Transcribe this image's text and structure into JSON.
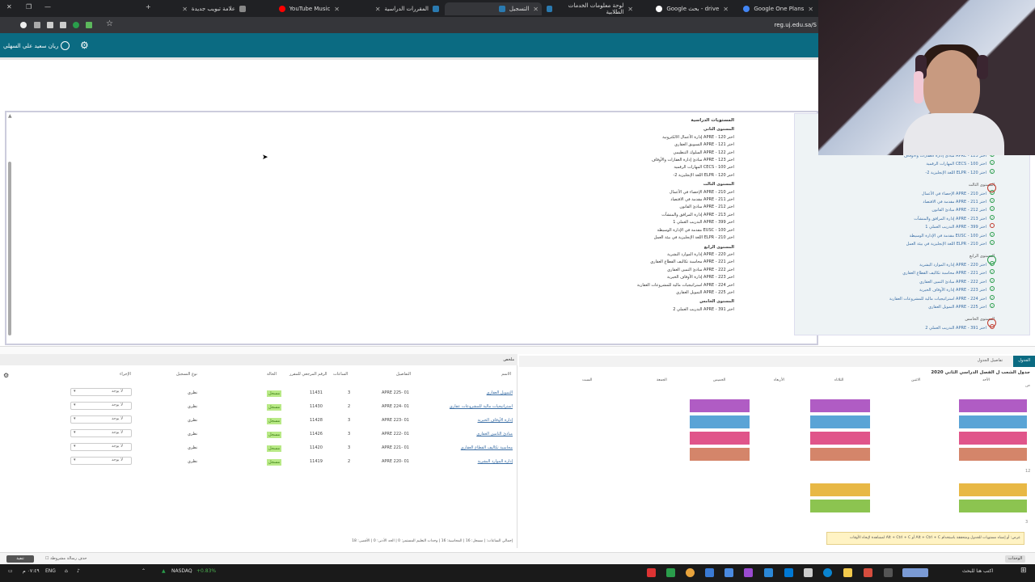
{
  "browser": {
    "tabs": [
      {
        "label": "علامة تبويب جديدة",
        "active": false
      },
      {
        "label": "YouTube Music",
        "active": false
      },
      {
        "label": "المقررات الدراسية",
        "active": false
      },
      {
        "label": "التسجيل",
        "active": true
      },
      {
        "label": "لوحة معلومات الخدمات الطلابية",
        "active": false
      },
      {
        "label": "drive - بحث Google",
        "active": false
      },
      {
        "label": "Google One Plans",
        "active": false
      }
    ],
    "url": "reg.uj.edu.sa/S"
  },
  "app": {
    "user_name": "ريان سعيد علي السهلي"
  },
  "plan": {
    "heading": "المستويات الدراسية",
    "levels": [
      {
        "title": "المستوى الثاني",
        "items": [
          "اختر APRE - 120 إدارة الأعمال الالكترونية",
          "اختر APRE - 121 التسويق العقاري",
          "اختر APRE - 122 السلوك التنظيمي",
          "اختر APRE - 123 مبادئ إدارة العقارات والأوقاف",
          "اختر CECS - 100 المهارات الرقمية",
          "اختر ELPR - 120 اللغة الإنجليزية 2-"
        ]
      },
      {
        "title": "المستوى الثالث",
        "items": [
          "اختر APRE - 210 الإحصاء في الأعمال",
          "اختر APRE - 211 مقدمة في الاقتصاد",
          "اختر APRE - 212 مبادئ القانون",
          "اختر APRE - 213 إدارة المرافق والمنشآت",
          "اختر APRE - 399 التدريب العملي 1",
          "اختر EUSC - 100 مقدمة في الإدارة الوسيطة",
          "اختر ELPR - 210 اللغة الإنجليزية في بيئة العمل"
        ]
      },
      {
        "title": "المستوى الرابع",
        "items": [
          "اختر APRE - 220 إدارة الموارد البشرية",
          "اختر APRE - 221 محاسبة تكاليف القطاع العقاري",
          "اختر APRE - 222 مبادئ التمين العقاري",
          "اختر APRE - 223 إدارة الأوقاف الخيرية",
          "اختر APRE - 224 استراتيجيات مالية للمشروعات العقارية",
          "اختر APRE - 225 التمويل العقاري"
        ]
      },
      {
        "title": "المستوى الخامس",
        "items": [
          "اختر APRE - 391 التدريب العملي 2"
        ]
      }
    ]
  },
  "progress_panel": {
    "items": [
      {
        "text": "اختر APRE - 123 مبادئ إدارة العقارات والأوقاف",
        "state": "ok"
      },
      {
        "text": "اختر CECS - 100 المهارات الرقمية",
        "state": "ok"
      },
      {
        "text": "اختر ELPR - 120 اللغة الإنجليزية 2-",
        "state": "ok"
      },
      {
        "level": "المستوى الثالث",
        "status": "pending"
      },
      {
        "text": "اختر APRE - 210 الإحصاء في الأعمال",
        "state": "ok"
      },
      {
        "text": "اختر APRE - 211 مقدمة في الاقتصاد",
        "state": "ok"
      },
      {
        "text": "اختر APRE - 212 مبادئ القانون",
        "state": "ok"
      },
      {
        "text": "اختر APRE - 213 إدارة المرافق والمنشآت",
        "state": "ok"
      },
      {
        "text": "اختر APRE - 399 التدريب العملي 1",
        "state": "no"
      },
      {
        "text": "اختر EUSC - 100 مقدمة في الإدارة الوسيطة",
        "state": "ok"
      },
      {
        "text": "اختر ELPR - 210 اللغة الإنجليزية في بيئة العمل",
        "state": "ok"
      },
      {
        "level": "المستوى الرابع",
        "status": "done"
      },
      {
        "text": "اختر APRE - 220 إدارة الموارد البشرية",
        "state": "ok"
      },
      {
        "text": "اختر APRE - 221 محاسبة تكاليف القطاع العقاري",
        "state": "ok"
      },
      {
        "text": "اختر APRE - 222 مبادئ التمين العقاري",
        "state": "ok"
      },
      {
        "text": "اختر APRE - 223 إدارة الأوقاف الخيرية",
        "state": "ok"
      },
      {
        "text": "اختر APRE - 224 استراتيجيات مالية للمشروعات العقارية",
        "state": "ok"
      },
      {
        "text": "اختر APRE - 225 التمويل العقاري",
        "state": "ok"
      },
      {
        "level": "المستوى الخامس",
        "status": "pending"
      },
      {
        "text": "اختر APRE - 391 التدريب العملي 2",
        "state": "no"
      }
    ]
  },
  "summary": {
    "title": "ملخص",
    "columns": {
      "name": "الاسم",
      "details": "التفاصيل",
      "hours": "الساعات",
      "crn": "الرقم المرجعي للمقرر",
      "status": "الحالة",
      "type": "نوع التسجيل",
      "action": "الإجراء"
    },
    "rows": [
      {
        "name": "التمويل العقاري",
        "details": "APRE 225- 01",
        "hours": "3",
        "crn": "11431",
        "status": "مسجل",
        "type": "نظري",
        "action": "لا يوجد"
      },
      {
        "name": "استراتيجيات مالية للمشروعات عقاري",
        "details": "APRE 224- 01",
        "hours": "2",
        "crn": "11430",
        "status": "مسجل",
        "type": "نظري",
        "action": "لا يوجد"
      },
      {
        "name": "إدارة الأوقاف الخيرية",
        "details": "APRE 223- 01",
        "hours": "3",
        "crn": "11428",
        "status": "مسجل",
        "type": "نظري",
        "action": "لا يوجد"
      },
      {
        "name": "مبادئ التامين العقاري",
        "details": "APRE 222- 01",
        "hours": "3",
        "crn": "11426",
        "status": "مسجل",
        "type": "نظري",
        "action": "لا يوجد"
      },
      {
        "name": "محاسبة تكاليف القطاع العقاري",
        "details": "APRE 221- 01",
        "hours": "3",
        "crn": "11420",
        "status": "مسجل",
        "type": "نظري",
        "action": "لا يوجد"
      },
      {
        "name": "إدارة الموارد البشرية",
        "details": "APRE 220- 01",
        "hours": "2",
        "crn": "11419",
        "status": "مسجل",
        "type": "نظري",
        "action": "لا يوجد"
      }
    ],
    "footer": "إجمالي الساعات: | مسجل: 16 | المحاسبة: 16 | وحدات التعليم المستمر: 0 | الحد الأدنى: 0 | الأقصى: 18"
  },
  "schedule": {
    "tab_active": "الجدول",
    "tab_other": "تفاصيل الجدول",
    "title": "جدول الشعب ل الفصل الدراسي الثاني 2020",
    "days": [
      "الأحد",
      "الاثنين",
      "الثلاثاء",
      "الأربعاء",
      "الخميس",
      "الجمعة",
      "السبت"
    ],
    "hours": [
      "ص",
      "12",
      "3"
    ],
    "notice": "عرض: أو إنشاء مستويات للجدول ومتحققة باستخدام Alt + Ctrl + C أو Alt + Ctrl + C لمشاهدة لإيحاء الأوقات"
  },
  "strip": {
    "cancel": "تنفيذ",
    "checkbox": "حذف رسالة مشروطة",
    "right": "الوحدات"
  },
  "taskbar": {
    "ticker": "NASDAQ",
    "ticker_change": "+0.83%",
    "lang": "ENG",
    "time": "٠٧:٤٩ م",
    "date": "٢٠٢٤/٠٧/٠٩",
    "search": "اكتب هنا للبحث"
  }
}
